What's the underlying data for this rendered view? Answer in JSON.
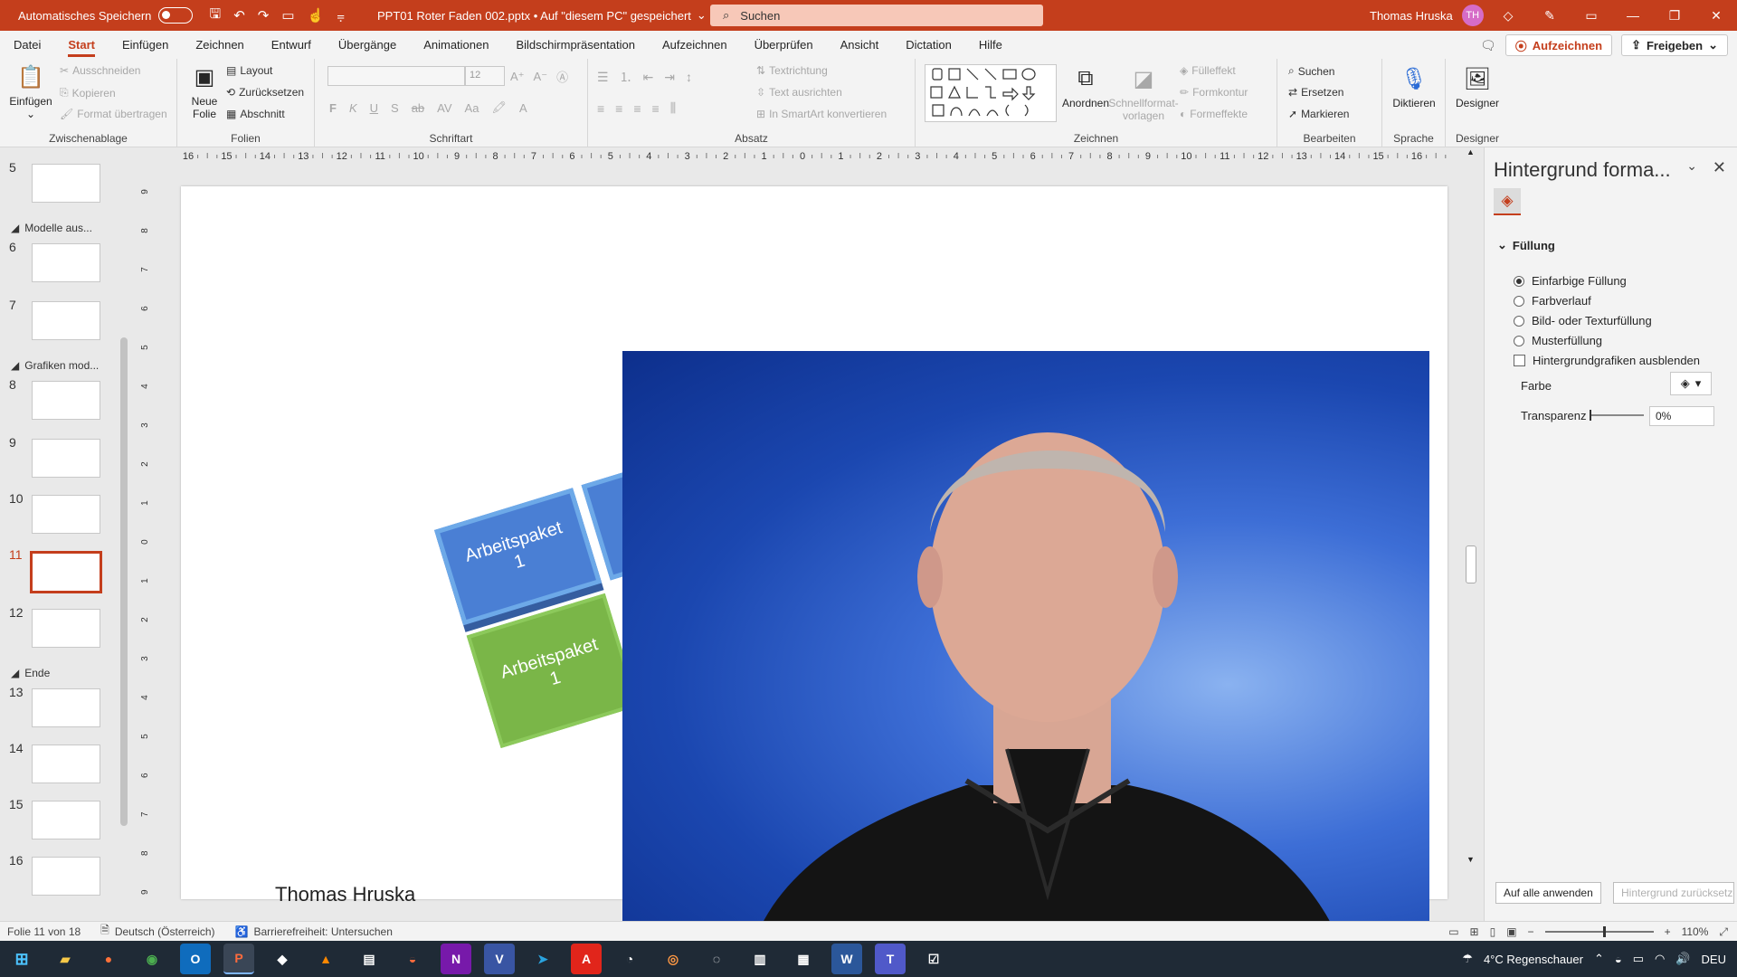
{
  "titlebar": {
    "autosave_label": "Automatisches Speichern",
    "filename": "PPT01 Roter Faden 002.pptx • Auf \"diesem PC\" gespeichert",
    "search_placeholder": "Suchen",
    "user_name": "Thomas Hruska",
    "user_initials": "TH"
  },
  "tabs": [
    "Datei",
    "Start",
    "Einfügen",
    "Zeichnen",
    "Entwurf",
    "Übergänge",
    "Animationen",
    "Bildschirmpräsentation",
    "Aufzeichnen",
    "Überprüfen",
    "Ansicht",
    "Dictation",
    "Hilfe"
  ],
  "tabs_right": {
    "record": "Aufzeichnen",
    "share": "Freigeben"
  },
  "ribbon": {
    "clipboard": {
      "label": "Zwischenablage",
      "paste": "Einfügen",
      "cut": "Ausschneiden",
      "copy": "Kopieren",
      "format_painter": "Format übertragen"
    },
    "slides": {
      "label": "Folien",
      "new_slide_1": "Neue",
      "new_slide_2": "Folie",
      "layout": "Layout",
      "reset": "Zurücksetzen",
      "section": "Abschnitt"
    },
    "font": {
      "label": "Schriftart",
      "size": "12"
    },
    "paragraph": {
      "label": "Absatz",
      "text_direction": "Textrichtung",
      "align_text": "Text ausrichten",
      "smartart": "In SmartArt konvertieren"
    },
    "drawing": {
      "label": "Zeichnen",
      "arrange": "Anordnen",
      "quickstyles_1": "Schnellformat-",
      "quickstyles_2": "vorlagen",
      "fill": "Fülleffekt",
      "outline": "Formkontur",
      "effects": "Formeffekte"
    },
    "editing": {
      "label": "Bearbeiten",
      "find": "Suchen",
      "replace": "Ersetzen",
      "select": "Markieren"
    },
    "voice": {
      "label": "Sprache",
      "dictate": "Diktieren"
    },
    "designer": {
      "label": "Designer",
      "button": "Designer"
    }
  },
  "slides_panel": {
    "sections": [
      "Modelle aus...",
      "Grafiken mod...",
      "Ende"
    ],
    "numbers": [
      "5",
      "6",
      "7",
      "8",
      "9",
      "10",
      "11",
      "12",
      "13",
      "14",
      "15",
      "16"
    ],
    "active": "11"
  },
  "slide": {
    "box_text_1": "Arbeitspaket",
    "box_text_2": "1",
    "author": "Thomas Hruska"
  },
  "format_pane": {
    "title": "Hintergrund forma...",
    "section": "Füllung",
    "options": [
      "Einfarbige Füllung",
      "Farbverlauf",
      "Bild- oder Texturfüllung",
      "Musterfüllung"
    ],
    "selected": "Einfarbige Füllung",
    "hide_graphics": "Hintergrundgrafiken ausblenden",
    "color_label": "Farbe",
    "transparency_label": "Transparenz",
    "transparency_value": "0%",
    "apply_all": "Auf alle anwenden",
    "reset_bg": "Hintergrund zurücksetze"
  },
  "statusbar": {
    "slide_info": "Folie 11 von 18",
    "language": "Deutsch (Österreich)",
    "accessibility": "Barrierefreiheit: Untersuchen",
    "zoom": "110%"
  },
  "taskbar": {
    "weather": "4°C  Regenschauer",
    "lang": "DEU"
  },
  "ruler_numbers": [
    "16",
    "15",
    "14",
    "13",
    "12",
    "11",
    "10",
    "9",
    "8",
    "7",
    "6",
    "5",
    "4",
    "3",
    "2",
    "1",
    "0",
    "1",
    "2",
    "3",
    "4",
    "5",
    "6",
    "7",
    "8",
    "9",
    "10",
    "11",
    "12",
    "13",
    "14",
    "15",
    "16"
  ],
  "vruler_numbers": [
    "9",
    "8",
    "7",
    "6",
    "5",
    "4",
    "3",
    "2",
    "1",
    "0",
    "1",
    "2",
    "3",
    "4",
    "5",
    "6",
    "7",
    "8",
    "9"
  ],
  "colors": {
    "accent": "#c43e1c",
    "box_blue": "#4a7fd4",
    "box_green": "#7ab648"
  }
}
